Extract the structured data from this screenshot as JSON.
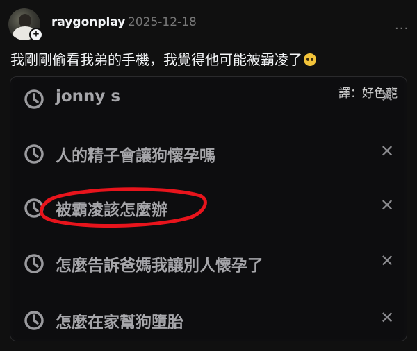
{
  "post": {
    "username": "raygonplay",
    "date": "2025-12-18",
    "text": "我剛剛偷看我弟的手機，我覺得他可能被霸凌了",
    "emoji": "worried-face-emoji",
    "more_label": "..."
  },
  "embed": {
    "watermark": "譯：好色龍",
    "history": [
      {
        "text": "jonny s"
      },
      {
        "text": "人的精子會讓狗懷孕嗎"
      },
      {
        "text": "被霸凌該怎麼辦",
        "circled": true
      },
      {
        "text": "怎麼告訴爸媽我讓別人懷孕了"
      },
      {
        "text": "怎麼在家幫狗墮胎"
      }
    ],
    "remove_label": "✕"
  },
  "colors": {
    "background": "#101010",
    "annotation_circle": "#e8141c"
  }
}
